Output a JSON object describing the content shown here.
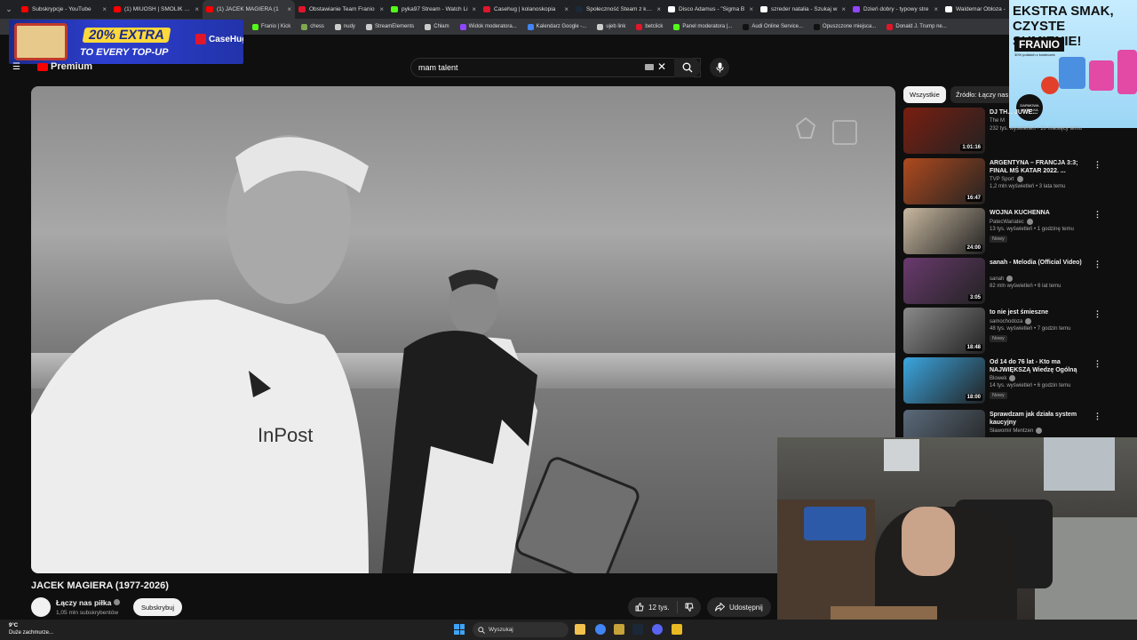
{
  "tabs": [
    {
      "label": "Subskrypcje - YouTube",
      "color": "#ff0000"
    },
    {
      "label": "(1) MIUOSH | SMOLIK | N",
      "color": "#ff0000"
    },
    {
      "label": "(1) JACEK MAGIERA (1",
      "color": "#ff0000",
      "active": true
    },
    {
      "label": "Obstawianie Team Franio",
      "color": "#e0162b"
    },
    {
      "label": "pyka97 Stream - Watch Li",
      "color": "#53fc18"
    },
    {
      "label": "Casehug | kolanoskopia",
      "color": "#e0162b"
    },
    {
      "label": "Społeczność Steam z kolu",
      "color": "#1b2838"
    },
    {
      "label": "Disco Adamus - \"Sigma B",
      "color": "#ffffff"
    },
    {
      "label": "szreder natalia - Szukaj w",
      "color": "#ffffff"
    },
    {
      "label": "Dzień dobry - typowy stre",
      "color": "#9146ff"
    },
    {
      "label": "Waldemar Obloza -",
      "color": "#ffffff"
    }
  ],
  "bookmarks": [
    {
      "label": "Franio | Kick",
      "color": "#53fc18"
    },
    {
      "label": "chess",
      "color": "#7fa650"
    },
    {
      "label": "nudy",
      "color": "#cccccc"
    },
    {
      "label": "StreamElements",
      "color": "#cccccc"
    },
    {
      "label": "Chłam",
      "color": "#cccccc"
    },
    {
      "label": "Widok moderatora...",
      "color": "#9146ff"
    },
    {
      "label": "Kalendarz Google -...",
      "color": "#4285f4"
    },
    {
      "label": "ujeb link",
      "color": "#cccccc"
    },
    {
      "label": "betclick",
      "color": "#e0162b"
    },
    {
      "label": "Panel moderatora |...",
      "color": "#53fc18"
    },
    {
      "label": "Audi Online Service...",
      "color": "#111111"
    },
    {
      "label": "Opuszczone miejsca...",
      "color": "#111111"
    },
    {
      "label": "Donald J. Trump ne...",
      "color": "#e0162b"
    }
  ],
  "ad_banner": {
    "promo": "20% EXTRA",
    "promo2": "TO EVERY TOP-UP",
    "brand": "CaseHug"
  },
  "header": {
    "logo": "Premium",
    "search_query": "mam talent"
  },
  "video": {
    "title": "JACEK MAGIERA (1977-2026)",
    "channel_name": "Łączy nas piłka",
    "channel_subs": "1,05 mln subskrybentów",
    "subscribe_label": "Subskrybuj",
    "likes": "12 tys.",
    "share_label": "Udostępnij"
  },
  "chips": {
    "all": "Wszystkie",
    "source": "Źródło: Łączy nas piłka"
  },
  "side_ad": {
    "headline": "EKSTRA SMAK, CZYSTE SUMIENIE!",
    "brand": "FRANIO",
    "small": "30% polskich z kosteczek",
    "badge": "DARMOWA WYSYŁKA"
  },
  "recommendations": [
    {
      "title": "DJ TH... JUWE...",
      "channel": "The M",
      "meta": "232 tys. wyświetleń • 10 miesięcy temu",
      "duration": "1:01:16",
      "new": "",
      "verified": false,
      "thumb": "#7a1e10"
    },
    {
      "title": "ARGENTYNA – FRANCJA 3:3; FINAŁ MŚ KATAR 2022. ...",
      "channel": "TVP Sport",
      "meta": "1,2 mln wyświetleń • 3 lata temu",
      "duration": "16:47",
      "new": "",
      "verified": true,
      "thumb": "#b04a1e"
    },
    {
      "title": "WOJNA KUCHENNA",
      "channel": "PatecWariatec",
      "meta": "13 tys. wyświetleń • 1 godzinę temu",
      "duration": "24:00",
      "new": "Nowy",
      "verified": true,
      "thumb": "#c8b8a0"
    },
    {
      "title": "sanah - Melodia (Official Video)",
      "channel": "sanah",
      "meta": "82 mln wyświetleń • 6 lat temu",
      "duration": "3:05",
      "new": "",
      "verified": true,
      "thumb": "#6a3a6e"
    },
    {
      "title": "to nie jest śmieszne",
      "channel": "samochodoza",
      "meta": "48 tys. wyświetleń • 7 godzin temu",
      "duration": "18:48",
      "new": "Nowy",
      "verified": true,
      "thumb": "#8a8a8a"
    },
    {
      "title": "Od 14 do 76 lat - Kto ma NAJWIĘKSZĄ Wiedzę Ogólną",
      "channel": "Blowek",
      "meta": "14 tys. wyświetleń • 6 godzin temu",
      "duration": "18:00",
      "new": "Nowy",
      "verified": true,
      "thumb": "#3ba6e0"
    },
    {
      "title": "Sprawdzam jak działa system kaucyjny",
      "channel": "Sławomir Mentzen",
      "meta": "",
      "duration": "",
      "new": "",
      "verified": true,
      "thumb": "#5a6a7a"
    }
  ],
  "taskbar": {
    "temp": "9°C",
    "weather": "Duże zachmurze...",
    "search": "Wyszukaj"
  }
}
